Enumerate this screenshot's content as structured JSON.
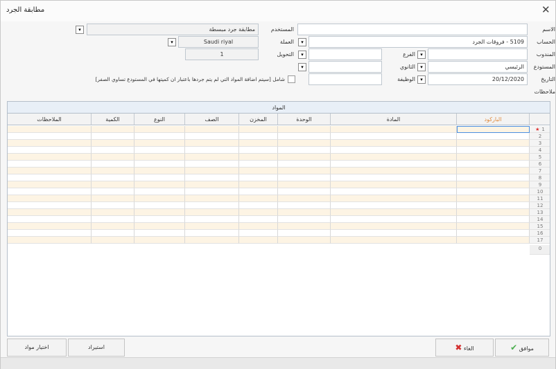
{
  "window": {
    "title": "مطابقة الجرد",
    "close_glyph": "✕"
  },
  "form": {
    "name_label": "الاسم",
    "name_value": "",
    "account_label": "الحساب",
    "account_value": "5109 - فروقات الجرد",
    "delegate_label": "المندوب",
    "delegate_value": "",
    "warehouse_label": "المستودع",
    "warehouse_value": "الرئيسي",
    "date_label": "التاريخ",
    "date_value": "20/12/2020",
    "notes_label": "ملاحظات",
    "branch_label": "الفرع",
    "branch_value": "",
    "secondary_label": "الثانوي",
    "secondary_value": "",
    "job_label": "الوظيفة",
    "job_value": "",
    "used_label": "المستخدم",
    "used_value": "مطابقة جرد مبسطة",
    "currency_label": "العملة",
    "currency_value": "Saudi riyal",
    "conversion_label": "التحويل",
    "conversion_value": "1",
    "include_notice": "شامل [سيتم اضافة المواد التي لم يتم جردها باعتبار ان كميتها في المستودع تساوي الصفر]"
  },
  "grid": {
    "title": "المواد",
    "columns": [
      "الباركود",
      "المادة",
      "الوحدة",
      "المخزن",
      "الصف",
      "النوع",
      "الكمية",
      "الملاحظات"
    ],
    "row_numbers": [
      "1",
      "2",
      "3",
      "4",
      "5",
      "6",
      "7",
      "8",
      "9",
      "10",
      "11",
      "12",
      "13",
      "14",
      "15",
      "16",
      "17"
    ],
    "footer_count": "0"
  },
  "buttons": {
    "ok": "موافق",
    "cancel": "الغاء",
    "import": "استيراد",
    "select_items": "اختيار مواد"
  },
  "colors": {
    "accent_header": "#e08a3d",
    "row_alt": "#fdf4e4",
    "ok_green": "#4caf50",
    "cancel_red": "#d32f2f"
  }
}
